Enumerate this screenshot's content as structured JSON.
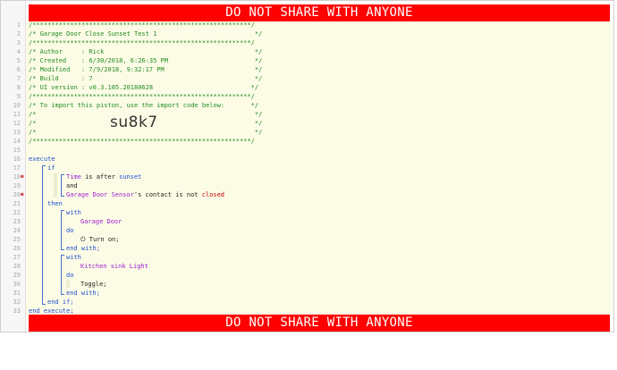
{
  "banner": {
    "top": "DO NOT SHARE WITH ANYONE",
    "bottom": "DO NOT SHARE WITH ANYONE"
  },
  "line_numbers": [
    "1",
    "2",
    "3",
    "4",
    "5",
    "6",
    "7",
    "8",
    "9",
    "10",
    "11",
    "12",
    "13",
    "14",
    "15",
    "16",
    "17",
    "18",
    "19",
    "20",
    "21",
    "22",
    "23",
    "24",
    "25",
    "26",
    "27",
    "28",
    "29",
    "30",
    "31",
    "32",
    "33"
  ],
  "header": {
    "rule": "/**********************************************************/",
    "title": "/* Garage Door Close Sunset Test 1                          */",
    "author": "/* Author     : Rick                                        */",
    "created": "/* Created    : 6/30/2018, 6:26:35 PM                       */",
    "modified": "/* Modified   : 7/9/2018, 9:32:17 PM                        */",
    "build": "/* Build      : 7                                           */",
    "ui_version": "/* UI version : v0.3.105.20180628                          */",
    "import_line": "/* To import this piston, use the import code below:       */",
    "blank1": "/*                                                          */",
    "blank2": "/*                                                          */",
    "blank3": "/*                                                          */",
    "import_code": "su8k7"
  },
  "code": {
    "execute": "execute",
    "if": "if",
    "cond1_device": "Time",
    "cond1_is": " is after ",
    "cond1_value": "sunset",
    "and": "and",
    "cond2_device": "Garage Door Sensor",
    "cond2_attr": "'s contact is not ",
    "cond2_value": "closed",
    "then": "then",
    "with1": "with",
    "with1_device": "Garage Door",
    "do1": "do",
    "cmd1_icon": "power-icon",
    "cmd1": "Turn on;",
    "endwith1": "end with;",
    "with2": "with",
    "with2_device": "Kitchen sink Light",
    "do2": "do",
    "cmd2": "Toggle;",
    "endwith2": "end with;",
    "endif": "end if;",
    "endexecute": "end execute;"
  },
  "colors": {
    "banner": "#ff0000",
    "comment": "#228b22",
    "keyword": "#1f4fcf",
    "device": "#9b1fcf",
    "value": "#c00000",
    "background": "#fcfce6"
  }
}
